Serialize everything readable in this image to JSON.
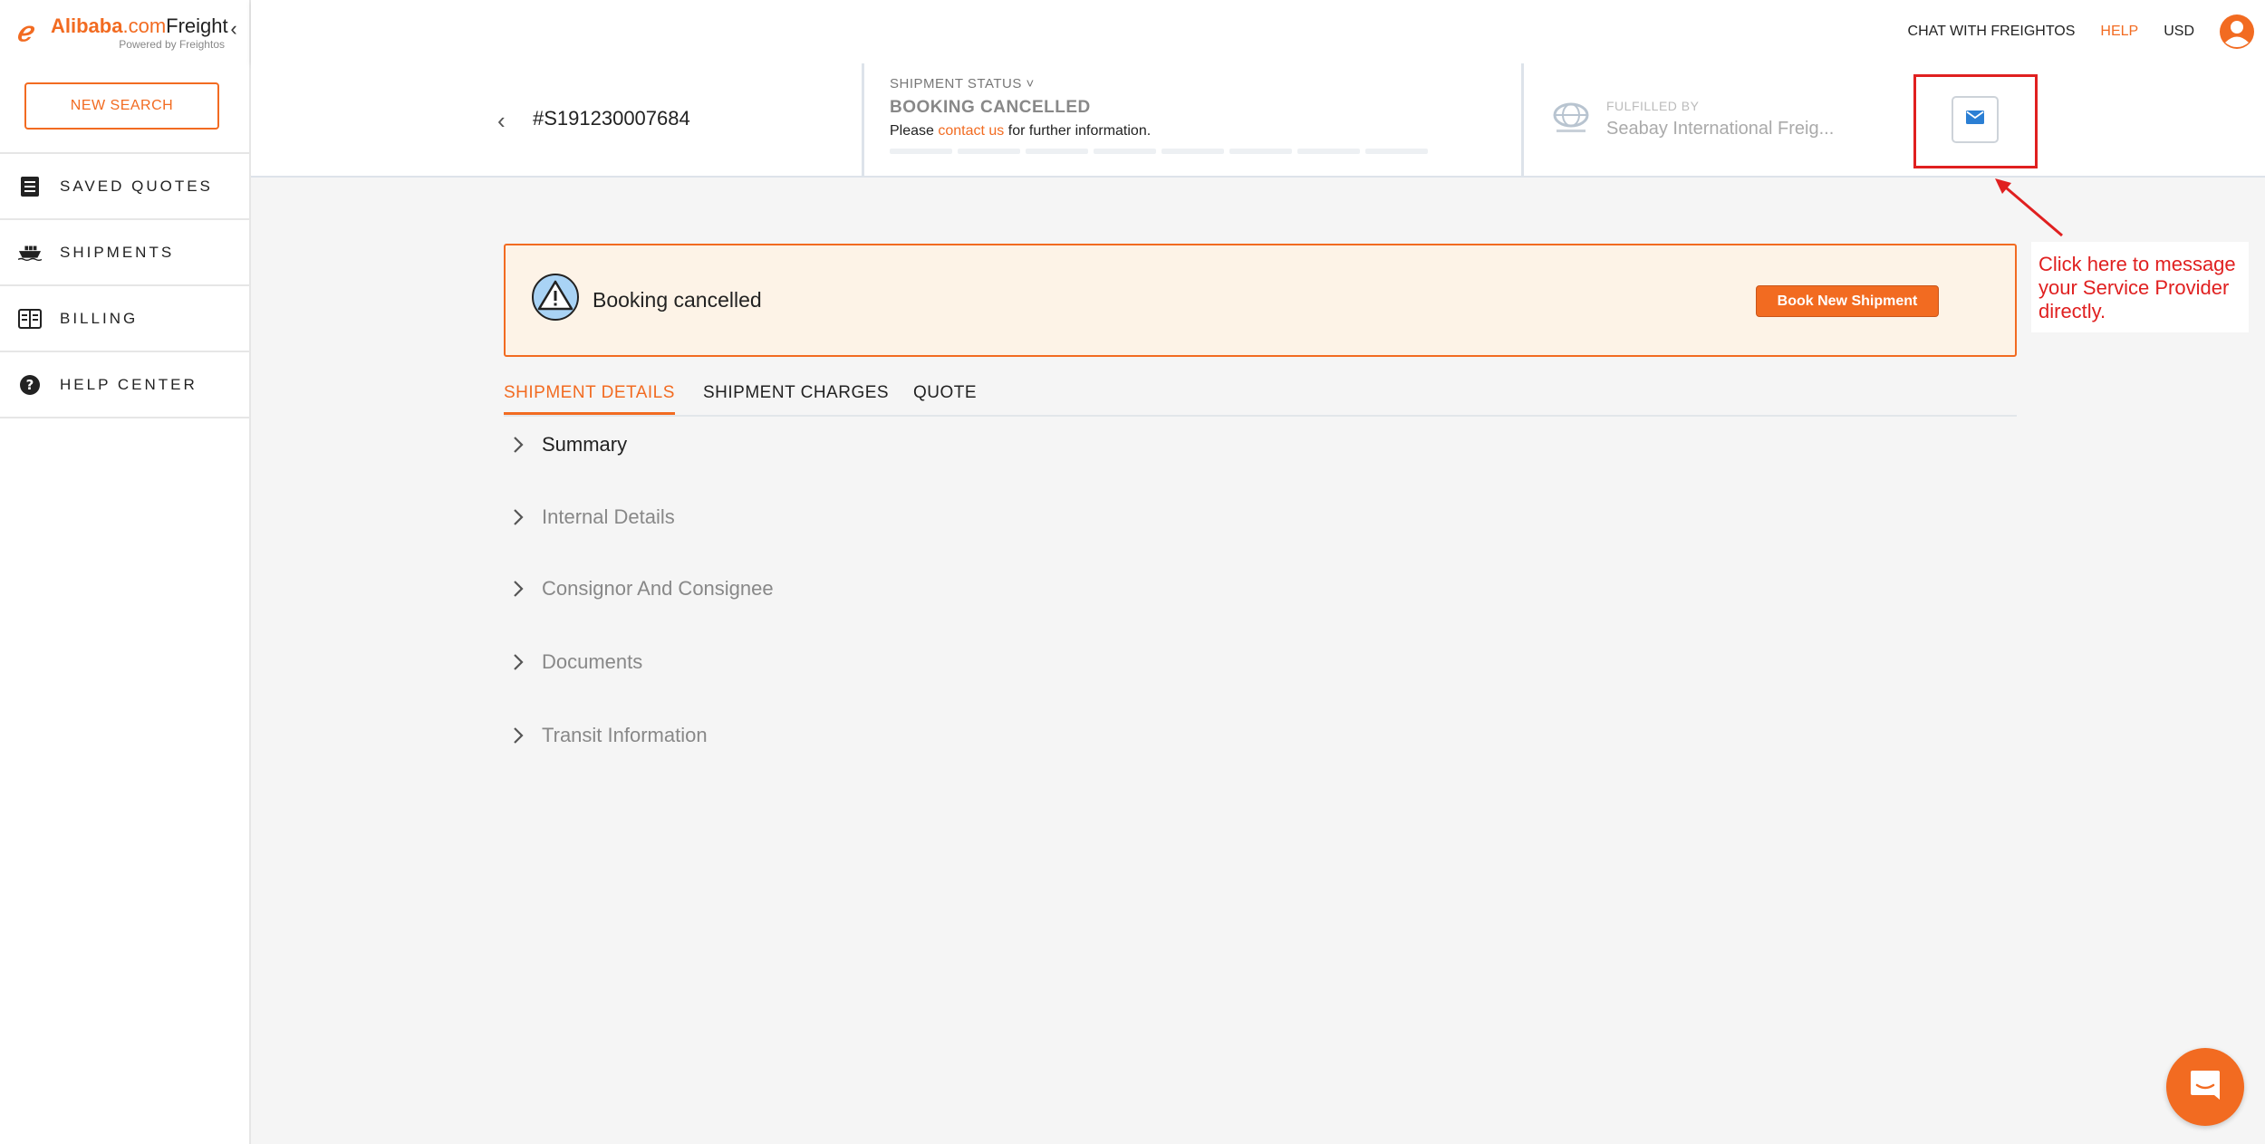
{
  "brand": {
    "name_part1": "Alibaba",
    "name_part2": ".com",
    "name_part3": "Freight",
    "subtitle": "Powered by Freightos",
    "accent_color": "#f26b21"
  },
  "sidebar": {
    "new_search_label": "NEW SEARCH",
    "collapse_glyph": "‹",
    "items": [
      {
        "label": "SAVED QUOTES",
        "icon": "document-list-icon"
      },
      {
        "label": "SHIPMENTS",
        "icon": "ship-icon"
      },
      {
        "label": "BILLING",
        "icon": "billing-icon"
      },
      {
        "label": "HELP CENTER",
        "icon": "question-circle-icon"
      }
    ]
  },
  "topbar": {
    "chat_label": "CHAT WITH FREIGHTOS",
    "help_label": "HELP",
    "currency_label": "USD",
    "avatar_icon": "user-avatar-icon"
  },
  "shipment": {
    "back_glyph": "‹",
    "id": "#S191230007684",
    "status_label": "SHIPMENT STATUS",
    "status_caret": "˅",
    "status_value": "BOOKING CANCELLED",
    "status_msg_before": "Please ",
    "status_msg_link": "contact us",
    "status_msg_after": " for further information.",
    "fulfilled_label": "FULFILLED BY",
    "provider_name": "Seabay International Freig...",
    "message_icon": "envelope-icon"
  },
  "annotation": {
    "text": "Click here to message your Service Provider directly.",
    "color": "#e02020"
  },
  "banner": {
    "text": "Booking cancelled",
    "button_label": "Book New Shipment",
    "icon": "warning-triangle-icon"
  },
  "tabs": [
    {
      "label": "SHIPMENT DETAILS",
      "active": true
    },
    {
      "label": "SHIPMENT CHARGES",
      "active": false
    },
    {
      "label": "QUOTE",
      "active": false
    }
  ],
  "sections": [
    {
      "title": "Summary"
    },
    {
      "title": "Internal Details"
    },
    {
      "title": "Consignor And Consignee"
    },
    {
      "title": "Documents"
    },
    {
      "title": "Transit Information"
    }
  ],
  "chat_widget": {
    "icon": "chat-bubble-icon"
  }
}
